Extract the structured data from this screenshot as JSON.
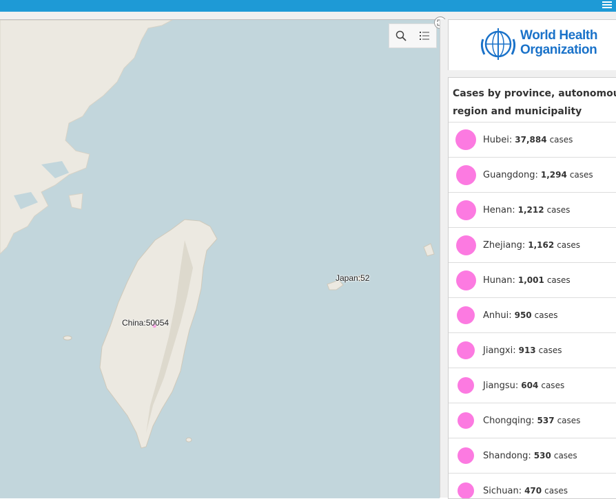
{
  "colors": {
    "topbar": "#1e9ad6",
    "water": "#c2d6dc",
    "land": "#ece9e1",
    "marker": "#fc7ae1",
    "who_blue": "#1a72c9"
  },
  "map": {
    "labels": [
      {
        "id": "china",
        "text": "China:50054"
      },
      {
        "id": "japan",
        "text": "Japan:52"
      }
    ],
    "tools": [
      {
        "name": "search-icon"
      },
      {
        "name": "legend-list-icon"
      }
    ]
  },
  "logo": {
    "line1": "World Health",
    "line2": "Organization"
  },
  "list": {
    "title_line1": "Cases by province, autonomous",
    "title_line2": "region and municipality",
    "unit": "cases",
    "items": [
      {
        "name": "Hubei:",
        "value": "37,884",
        "cases": 37884
      },
      {
        "name": "Guangdong:",
        "value": "1,294",
        "cases": 1294
      },
      {
        "name": "Henan:",
        "value": "1,212",
        "cases": 1212
      },
      {
        "name": "Zhejiang:",
        "value": "1,162",
        "cases": 1162
      },
      {
        "name": "Hunan:",
        "value": "1,001",
        "cases": 1001
      },
      {
        "name": "Anhui:",
        "value": "950",
        "cases": 950
      },
      {
        "name": "Jiangxi:",
        "value": "913",
        "cases": 913
      },
      {
        "name": "Jiangsu:",
        "value": "604",
        "cases": 604
      },
      {
        "name": "Chongqing:",
        "value": "537",
        "cases": 537
      },
      {
        "name": "Shandong:",
        "value": "530",
        "cases": 530
      },
      {
        "name": "Sichuan:",
        "value": "470",
        "cases": 470
      }
    ]
  }
}
